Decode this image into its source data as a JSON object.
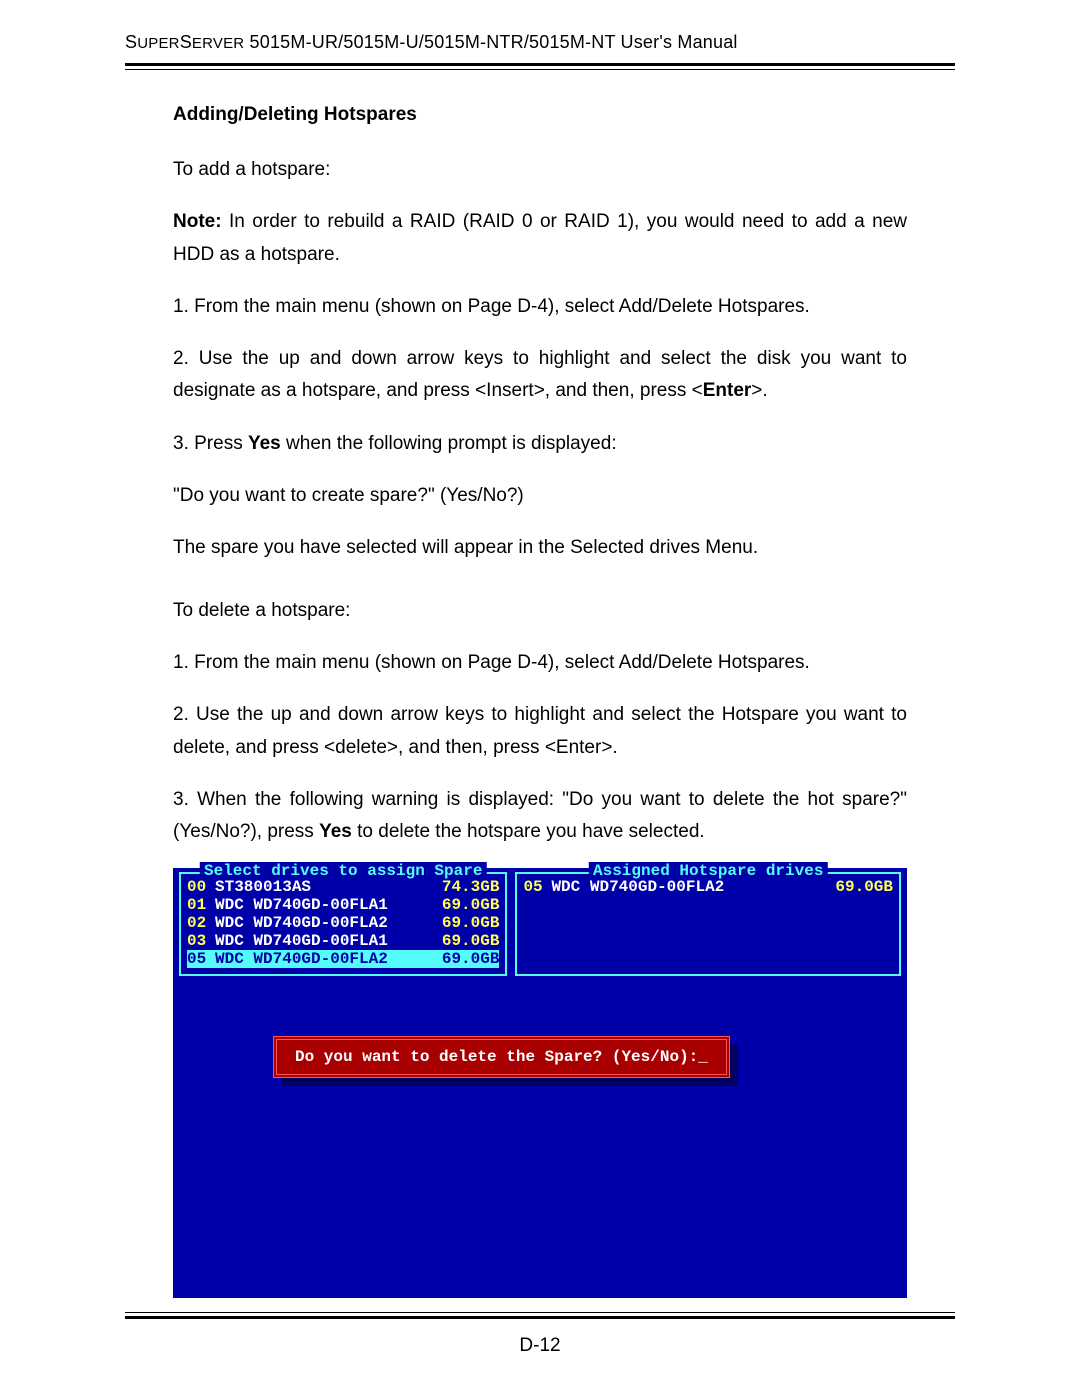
{
  "header": {
    "brand_small": "S",
    "brand_rest_1": "UPER",
    "brand_small_2": "S",
    "brand_rest_2": "ERVER",
    "models": " 5015M-UR/5015M-U/5015M-NTR/5015M-NT User's Manual"
  },
  "section_title": "Adding/Deleting Hotspares",
  "paragraphs": {
    "p1": "To add a hotspare:",
    "p2a": "Note:",
    "p2b": " In order to rebuild a RAID (RAID 0 or RAID 1), you would need to add a new HDD as a hotspare.",
    "p3": "1. From the main menu (shown on Page D-4), select Add/Delete Hotspares.",
    "p4a": "2. Use the up and down arrow keys to highlight and select the disk you want to designate as a hotspare, and press <Insert>, and then, press <",
    "p4b": "Enter",
    "p4c": ">.",
    "p5a": "3. Press ",
    "p5b": "Yes",
    "p5c": " when the following prompt is displayed:",
    "p6": "\"Do you want to create spare?\" (Yes/No?)",
    "p7": "The spare you have selected will appear in the Selected drives Menu.",
    "p8": "To delete a hotspare:",
    "p9": "1. From the main menu (shown on Page D-4), select Add/Delete Hotspares.",
    "p10": "2. Use the up and down arrow keys to highlight and select the Hotspare you want to delete, and press <delete>, and then, press <Enter>.",
    "p11a": "3. When the following warning is displayed: \"Do you want to delete the hot spare?\" (Yes/No?), press ",
    "p11b": "Yes",
    "p11c": " to delete the hotspare you have selected."
  },
  "screenshot": {
    "left_title": "Select drives to assign Spare",
    "right_title": "Assigned Hotspare drives",
    "left_drives": [
      {
        "idx": "00",
        "model": "ST380013AS",
        "size": "74.3GB"
      },
      {
        "idx": "01",
        "model": "WDC WD740GD-00FLA1",
        "size": "69.0GB"
      },
      {
        "idx": "02",
        "model": "WDC WD740GD-00FLA2",
        "size": "69.0GB"
      },
      {
        "idx": "03",
        "model": "WDC WD740GD-00FLA1",
        "size": "69.0GB"
      },
      {
        "idx": "05",
        "model": "WDC WD740GD-00FLA2",
        "size": "69.0GB"
      }
    ],
    "right_drives": [
      {
        "idx": "05",
        "model": "WDC WD740GD-00FLA2",
        "size": "69.0GB"
      }
    ],
    "dialog_text": "Do you want to delete the Spare? (Yes/No):_"
  },
  "page_number": "D-12"
}
